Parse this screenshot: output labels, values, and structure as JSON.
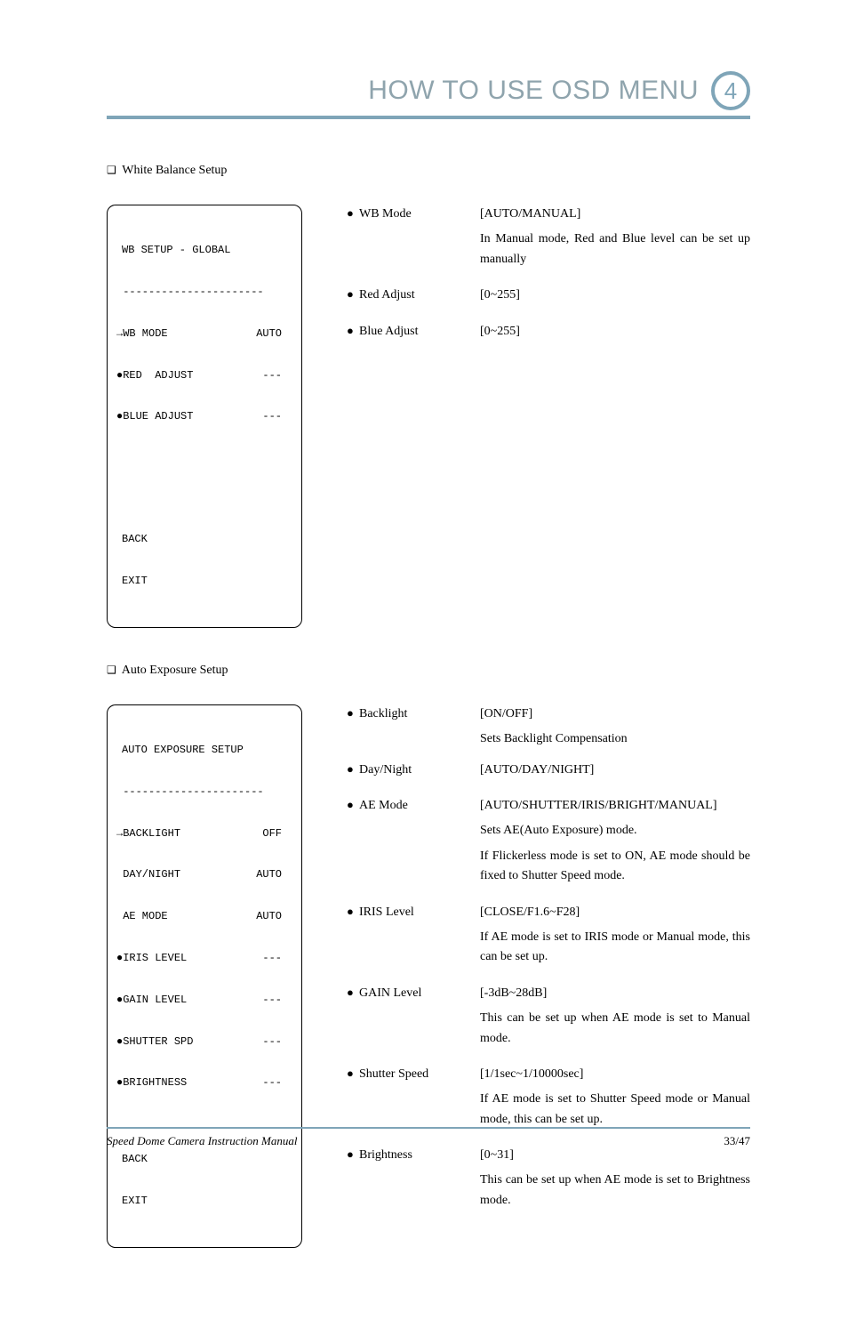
{
  "header": {
    "title": "HOW TO USE OSD MENU",
    "chapter": "4"
  },
  "section_wb": {
    "heading": "White Balance Setup",
    "osd": {
      "title": "WB SETUP - GLOBAL",
      "rows": [
        {
          "arrow": "→",
          "label": "WB MODE",
          "val": "AUTO"
        },
        {
          "arrow": "●",
          "label": "RED  ADJUST",
          "val": "---"
        },
        {
          "arrow": "●",
          "label": "BLUE ADJUST",
          "val": "---"
        }
      ],
      "back": "BACK",
      "exit": "EXIT"
    },
    "items": [
      {
        "label": "WB Mode",
        "range": "[AUTO/MANUAL]",
        "desc": "In Manual mode, Red and Blue level can be set up manually"
      },
      {
        "label": "Red Adjust",
        "range": "[0~255]",
        "desc": ""
      },
      {
        "label": "Blue Adjust",
        "range": "[0~255]",
        "desc": ""
      }
    ]
  },
  "section_ae": {
    "heading": "Auto Exposure Setup",
    "osd": {
      "title": "AUTO EXPOSURE SETUP",
      "rows": [
        {
          "arrow": "→",
          "label": "BACKLIGHT",
          "val": "OFF"
        },
        {
          "arrow": " ",
          "label": "DAY/NIGHT",
          "val": "AUTO"
        },
        {
          "arrow": " ",
          "label": "AE MODE",
          "val": "AUTO"
        },
        {
          "arrow": "●",
          "label": "IRIS LEVEL",
          "val": "---"
        },
        {
          "arrow": "●",
          "label": "GAIN LEVEL",
          "val": "---"
        },
        {
          "arrow": "●",
          "label": "SHUTTER SPD",
          "val": "---"
        },
        {
          "arrow": "●",
          "label": "BRIGHTNESS",
          "val": "---"
        }
      ],
      "back": "BACK",
      "exit": "EXIT"
    },
    "items": [
      {
        "label": "Backlight",
        "range": "[ON/OFF]",
        "desc": "Sets Backlight Compensation"
      },
      {
        "label": "Day/Night",
        "range": "[AUTO/DAY/NIGHT]",
        "desc": ""
      },
      {
        "label": "AE Mode",
        "range": "[AUTO/SHUTTER/IRIS/BRIGHT/MANUAL]",
        "desc": "Sets AE(Auto Exposure) mode.",
        "desc2": "If Flickerless mode is set to ON, AE mode should be fixed to Shutter Speed mode."
      },
      {
        "label": "IRIS Level",
        "range": "[CLOSE/F1.6~F28]",
        "desc": "If AE mode is set to IRIS mode or Manual mode, this can be set up."
      },
      {
        "label": "GAIN Level",
        "range": "[-3dB~28dB]",
        "desc": "This can be set up when AE mode is set to Manual mode."
      },
      {
        "label": "Shutter Speed",
        "range": "[1/1sec~1/10000sec]",
        "desc": "If AE mode is set to Shutter Speed mode or Manual mode, this can be set up."
      },
      {
        "label": "Brightness",
        "range": "[0~31]",
        "desc": "This can be set up when AE mode is set to Brightness mode."
      }
    ]
  },
  "footer": {
    "left": "Speed Dome Camera Instruction Manual",
    "right": "33/47"
  }
}
